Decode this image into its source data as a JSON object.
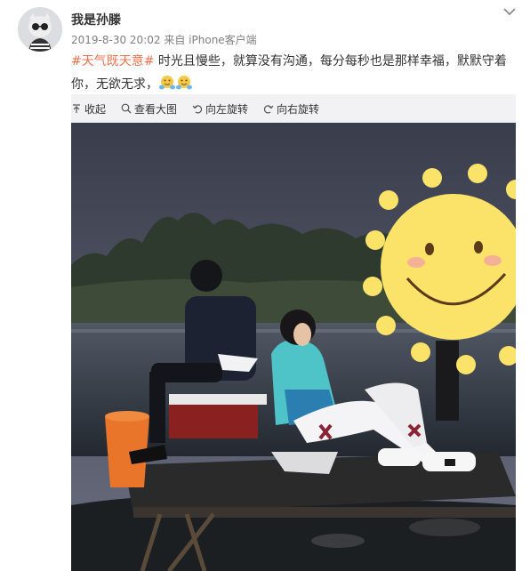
{
  "post": {
    "username": "我是孙滕",
    "timestamp": "2019-8-30 20:02",
    "source_prefix": "来自",
    "source": "iPhone客户端",
    "topic": "#天气既天意#",
    "text": " 时光且慢些，就算没有沟通，每分每秒也是那样幸福，默默守着你，无欲无求，"
  },
  "toolbar": {
    "collapse_label": "收起",
    "view_large_label": "查看大图",
    "rotate_left_label": "向左旋转",
    "rotate_right_label": "向右旋转"
  },
  "icons": {
    "menu": "chevron-down-icon",
    "collapse": "arrow-up-icon",
    "view_large": "magnifier-icon",
    "rotate_left": "rotate-left-icon",
    "rotate_right": "rotate-right-icon",
    "emoji": "hug-emoji"
  },
  "colors": {
    "topic": "#eb7350",
    "meta": "#808080",
    "media_background": "#f2f2f5",
    "sun_sticker": "#fbe36a"
  }
}
